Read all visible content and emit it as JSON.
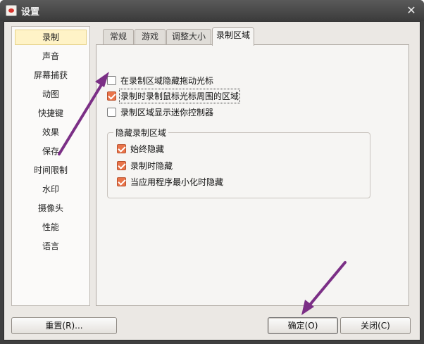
{
  "window": {
    "title": "设置"
  },
  "sidebar": {
    "items": [
      "录制",
      "声音",
      "屏幕捕获",
      "动图",
      "快捷键",
      "效果",
      "保存",
      "时间限制",
      "水印",
      "摄像头",
      "性能",
      "语言"
    ],
    "active_index": 0
  },
  "tabs": [
    "常规",
    "游戏",
    "调整大小",
    "录制区域"
  ],
  "active_tab": 3,
  "options": {
    "hide_cursor_drag": {
      "label": "在录制区域隐藏拖动光标",
      "checked": false
    },
    "record_cursor_area": {
      "label": "录制时录制鼠标光标周围的区域",
      "checked": true
    },
    "show_mini_controller": {
      "label": "录制区域显示迷你控制器",
      "checked": false
    }
  },
  "hide_group": {
    "title": "隐藏录制区域",
    "options": [
      {
        "label": "始终隐藏",
        "checked": true
      },
      {
        "label": "录制时隐藏",
        "checked": true
      },
      {
        "label": "当应用程序最小化时隐藏",
        "checked": true
      }
    ]
  },
  "buttons": {
    "reset": "重置(R)...",
    "ok": "确定(O)",
    "close": "关闭(C)"
  },
  "colors": {
    "annotation_arrow": "#7b2f86",
    "checkbox_checked": "#e9744a",
    "selection_highlight": "#fff3c7"
  }
}
